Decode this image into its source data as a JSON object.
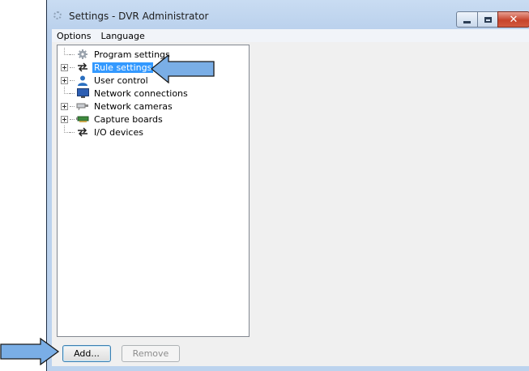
{
  "window": {
    "title": "Settings - DVR Administrator",
    "controls": {
      "minimize": "minimize",
      "maximize": "maximize",
      "close": "✕"
    }
  },
  "menu": [
    "Options",
    "Language"
  ],
  "tree": {
    "items": [
      {
        "label": "Program settings",
        "icon": "gear-icon",
        "expandable": false,
        "selected": false
      },
      {
        "label": "Rule settings",
        "icon": "arrows-exchange-icon",
        "expandable": true,
        "selected": true
      },
      {
        "label": "User control",
        "icon": "user-icon",
        "expandable": true,
        "selected": false
      },
      {
        "label": "Network connections",
        "icon": "monitor-icon",
        "expandable": false,
        "selected": false
      },
      {
        "label": "Network cameras",
        "icon": "camera-icon",
        "expandable": true,
        "selected": false
      },
      {
        "label": "Capture boards",
        "icon": "capture-board-icon",
        "expandable": true,
        "selected": false
      },
      {
        "label": "I/O devices",
        "icon": "arrows-exchange-icon",
        "expandable": false,
        "selected": false
      }
    ]
  },
  "buttons": {
    "add": "Add...",
    "remove": "Remove"
  },
  "colors": {
    "selection": "#3399ff",
    "callout_arrow": "#7aaee6",
    "close_button": "#c7442c"
  }
}
